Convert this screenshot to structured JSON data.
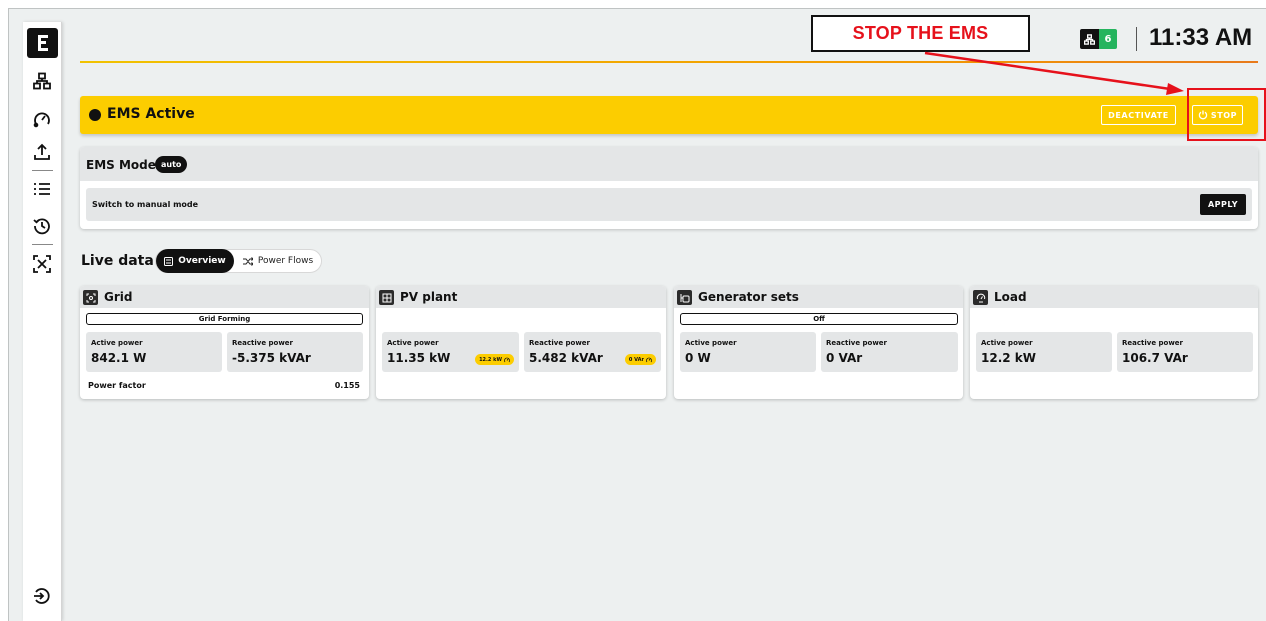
{
  "annotation": {
    "text": "STOP THE EMS"
  },
  "header": {
    "node_count": "6",
    "time": "11:33 AM",
    "accent_gradient": [
      "#f1c200",
      "#e87a1b"
    ]
  },
  "sidebar": {
    "items": [
      {
        "icon": "network-icon"
      },
      {
        "icon": "gauge-icon"
      },
      {
        "icon": "upload-icon"
      },
      {
        "icon": "list-icon"
      },
      {
        "icon": "history-icon"
      },
      {
        "icon": "scan-icon"
      }
    ],
    "bottom": {
      "icon": "logout-icon"
    }
  },
  "status": {
    "label": "EMS Active",
    "deactivate_label": "DEACTIVATE",
    "stop_label": "STOP",
    "bar_color": "#fccd00"
  },
  "mode": {
    "title": "EMS Mode",
    "badge": "auto",
    "switch_label": "Switch to manual mode",
    "apply_label": "APPLY"
  },
  "live": {
    "title": "Live data",
    "tabs": {
      "overview": "Overview",
      "power_flows": "Power Flows"
    }
  },
  "cards": {
    "grid": {
      "title": "Grid",
      "mode": "Grid Forming",
      "active_label": "Active power",
      "active_value": "842.1 W",
      "reactive_label": "Reactive power",
      "reactive_value": "-5.375 kVAr",
      "pf_label": "Power factor",
      "pf_value": "0.155"
    },
    "pv": {
      "title": "PV plant",
      "active_label": "Active power",
      "active_value": "11.35 kW",
      "active_setpoint": "12.2 kW",
      "reactive_label": "Reactive power",
      "reactive_value": "5.482 kVAr",
      "reactive_setpoint": "0 VAr"
    },
    "gen": {
      "title": "Generator sets",
      "mode": "Off",
      "active_label": "Active power",
      "active_value": "0 W",
      "reactive_label": "Reactive power",
      "reactive_value": "0 VAr"
    },
    "load": {
      "title": "Load",
      "active_label": "Active power",
      "active_value": "12.2 kW",
      "reactive_label": "Reactive power",
      "reactive_value": "106.7 VAr"
    }
  }
}
